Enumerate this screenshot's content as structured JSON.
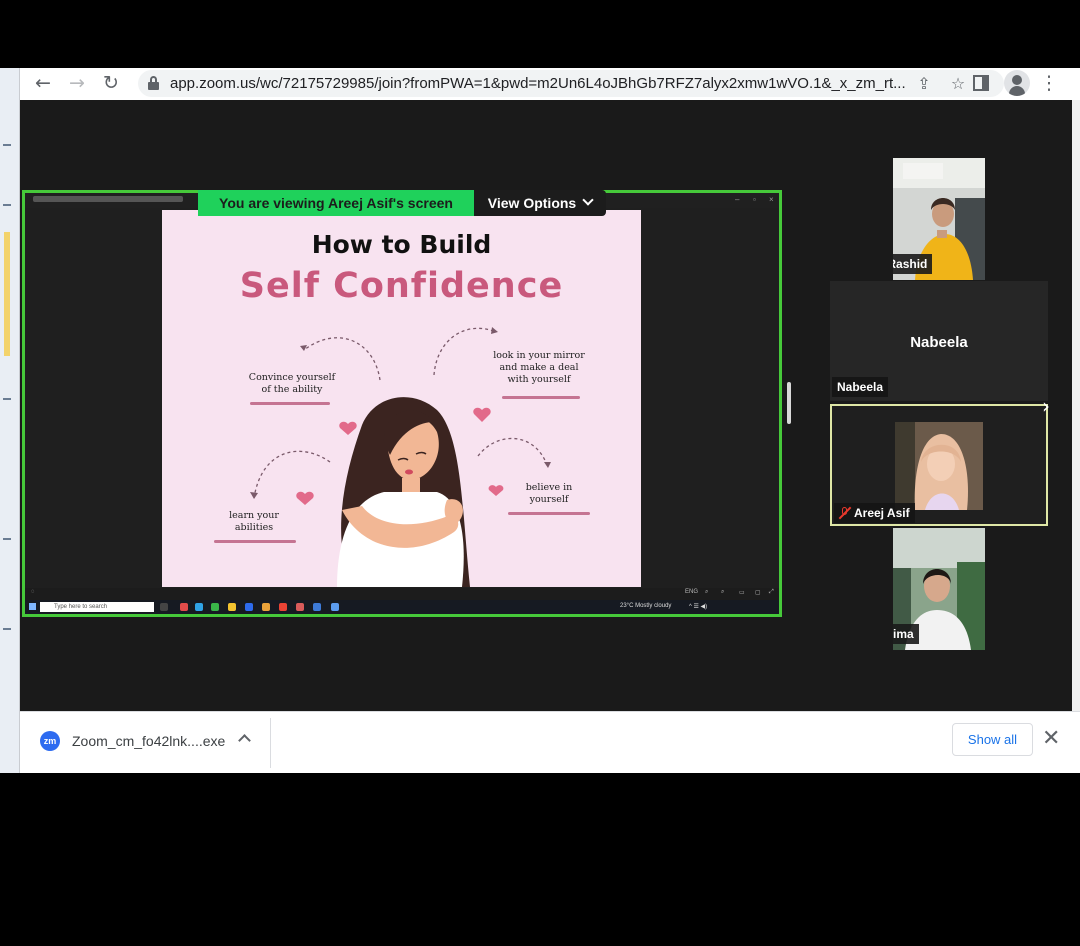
{
  "browser": {
    "url": "app.zoom.us/wc/72175729985/join?fromPWA=1&pwd=m2Un6L4oJBhGb7RFZ7alyx2xmw1wVO.1&_x_zm_rt...",
    "icons": [
      "back-icon",
      "forward-icon",
      "reload-icon",
      "lock-icon",
      "share-icon",
      "star-icon",
      "side-panel-icon",
      "profile-icon",
      "more-icon"
    ]
  },
  "meeting": {
    "share_banner": "You are viewing  Areej Asif's screen",
    "view_options": "View Options"
  },
  "slide": {
    "heading": "How to Build",
    "title": "Self Confidence",
    "tips": [
      "Convince yourself\nof the ability",
      "look in your mirror\nand make a deal\nwith yourself",
      "learn your\nabilities",
      "believe in\nyourself"
    ]
  },
  "taskbar": {
    "search_placeholder": "Type here to search",
    "weather": "23°C  Mostly cloudy"
  },
  "participants": [
    {
      "name": "Nabeela Rashid",
      "video": true,
      "muted": false
    },
    {
      "name": "Nabeela",
      "center_label": "Nabeela",
      "video": false,
      "muted": false
    },
    {
      "name": "Areej Asif",
      "video": true,
      "muted": true,
      "active": true
    },
    {
      "name": "Fatima",
      "video": true,
      "muted": true
    }
  ],
  "downloads": {
    "file_name": "Zoom_cm_fo42lnk....exe",
    "icon_label": "zm",
    "show_all": "Show all"
  },
  "colors": {
    "share_border": "#46c93a",
    "banner": "#1fd15b",
    "slide_bg": "#f8e3f0",
    "slide_title": "#c9597d",
    "muted_red": "#e8382c",
    "link_blue": "#1a73e8"
  }
}
